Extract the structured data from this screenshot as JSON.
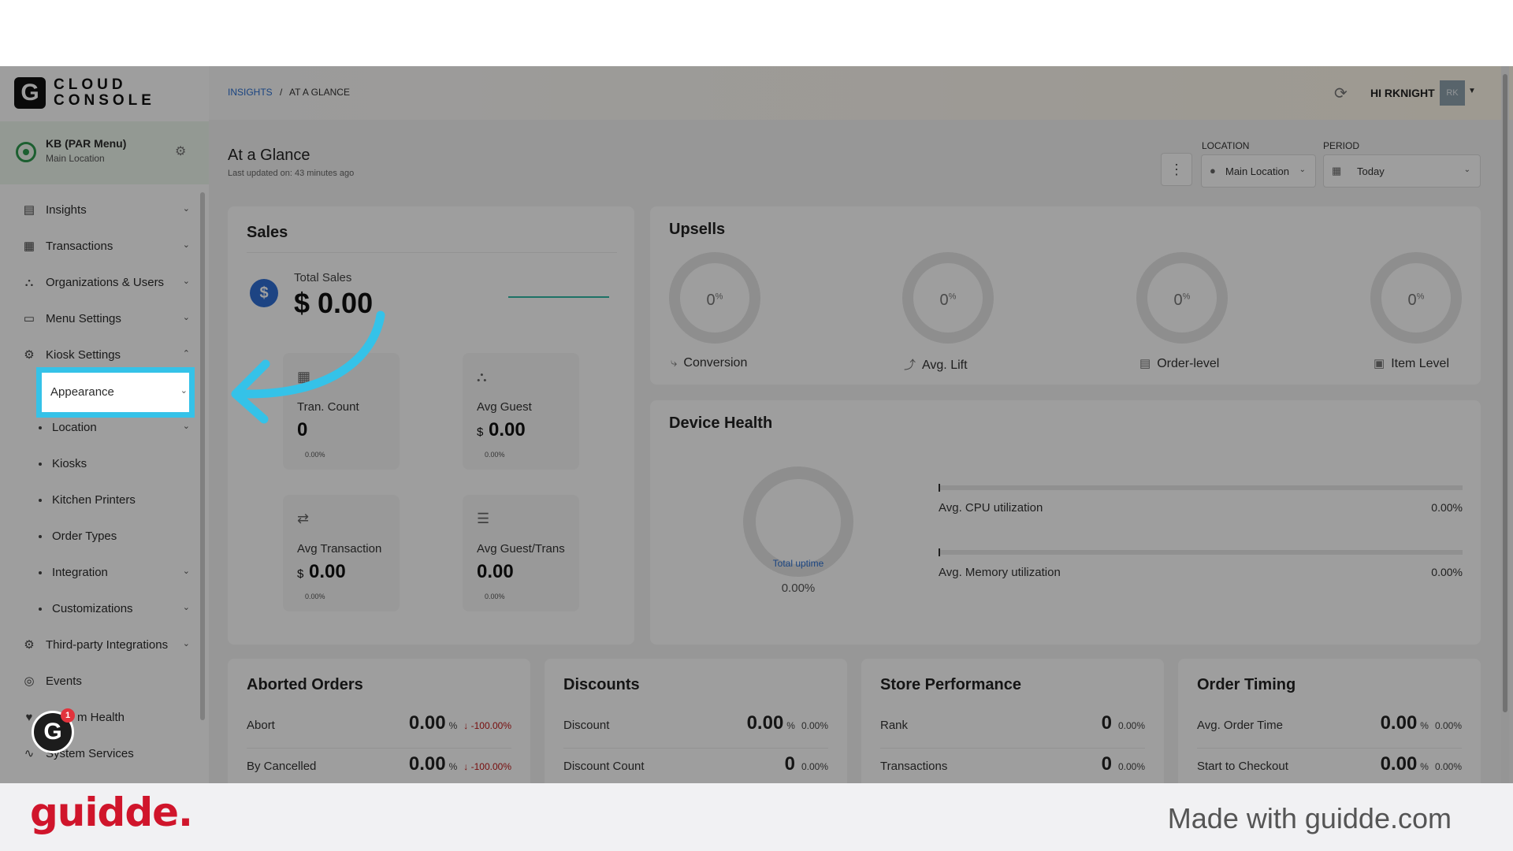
{
  "app": {
    "logo_letter": "G",
    "logo_line1": "CLOUD",
    "logo_line2": "CONSOLE"
  },
  "store": {
    "name": "KB (PAR Menu)",
    "location": "Main Location"
  },
  "sidebar": {
    "items": [
      {
        "label": "Insights",
        "icon": "chart-icon"
      },
      {
        "label": "Transactions",
        "icon": "receipt-icon"
      },
      {
        "label": "Organizations & Users",
        "icon": "org-icon"
      },
      {
        "label": "Menu Settings",
        "icon": "menu-icon"
      },
      {
        "label": "Kiosk Settings",
        "icon": "gear-icon"
      }
    ],
    "kiosk_sub": [
      "Appearance",
      "Location",
      "Kiosks",
      "Kitchen Printers",
      "Order Types",
      "Integration",
      "Customizations"
    ],
    "bottom": [
      {
        "label": "Third-party Integrations",
        "icon": "gear-icon"
      },
      {
        "label": "Events",
        "icon": "globe-icon"
      },
      {
        "label": "m Health",
        "icon": "heart-icon"
      },
      {
        "label": "System Services",
        "icon": "pulse-icon"
      }
    ],
    "grammarly_count": "1"
  },
  "topbar": {
    "breadcrumb_link": "INSIGHTS",
    "breadcrumb_sep": "/",
    "breadcrumb_current": "AT A GLANCE",
    "user": "HI RKNIGHT",
    "avatar_initials": "RK"
  },
  "header": {
    "title": "At a Glance",
    "updated": "Last updated on: 43 minutes ago",
    "location_label": "LOCATION",
    "location_value": "Main Location",
    "period_label": "PERIOD",
    "period_value": "Today"
  },
  "sales": {
    "title": "Sales",
    "total_label": "Total Sales",
    "total_value": "$ 0.00",
    "tiles": [
      {
        "label": "Tran. Count",
        "currency": "",
        "value": "0",
        "pct": "0.00%"
      },
      {
        "label": "Avg Guest",
        "currency": "$",
        "value": "0.00",
        "pct": "0.00%"
      },
      {
        "label": "Avg Transaction",
        "currency": "$",
        "value": "0.00",
        "pct": "0.00%"
      },
      {
        "label": "Avg Guest/Trans",
        "currency": "",
        "value": "0.00",
        "pct": "0.00%"
      }
    ]
  },
  "upsells": {
    "title": "Upsells",
    "items": [
      {
        "label": "Conversion",
        "pct": "0",
        "unit": "%"
      },
      {
        "label": "Avg. Lift",
        "pct": "0",
        "unit": "%"
      },
      {
        "label": "Order-level",
        "pct": "0",
        "unit": "%"
      },
      {
        "label": "Item Level",
        "pct": "0",
        "unit": "%"
      }
    ]
  },
  "device_health": {
    "title": "Device Health",
    "uptime_label": "Total uptime",
    "uptime_value": "0.00%",
    "cpu_label": "Avg. CPU utilization",
    "cpu_value": "0.00%",
    "mem_label": "Avg. Memory utilization",
    "mem_value": "0.00%"
  },
  "aborted": {
    "title": "Aborted Orders",
    "rows": [
      {
        "label": "Abort",
        "value": "0.00",
        "unit": "%",
        "delta": "↓ -100.00%"
      },
      {
        "label": "By Cancelled",
        "value": "0.00",
        "unit": "%",
        "delta": "↓ -100.00%"
      }
    ]
  },
  "discounts": {
    "title": "Discounts",
    "rows": [
      {
        "label": "Discount",
        "value": "0.00",
        "unit": "%",
        "pct": "0.00%"
      },
      {
        "label": "Discount Count",
        "value": "0",
        "unit": "",
        "pct": "0.00%"
      }
    ]
  },
  "store_perf": {
    "title": "Store Performance",
    "rows": [
      {
        "label": "Rank",
        "value": "0",
        "unit": "",
        "pct": "0.00%"
      },
      {
        "label": "Transactions",
        "value": "0",
        "unit": "",
        "pct": "0.00%"
      }
    ]
  },
  "order_timing": {
    "title": "Order Timing",
    "rows": [
      {
        "label": "Avg. Order Time",
        "value": "0.00",
        "unit": "%",
        "pct": "0.00%"
      },
      {
        "label": "Start to Checkout",
        "value": "0.00",
        "unit": "%",
        "pct": "0.00%"
      }
    ]
  },
  "footer": {
    "brand": "guidde.",
    "made_with": "Made with guidde.com"
  },
  "colors": {
    "accent_highlight": "#35c2e8",
    "link": "#2a6fd1",
    "brand_red": "#d0152b",
    "negative": "#c01818"
  }
}
